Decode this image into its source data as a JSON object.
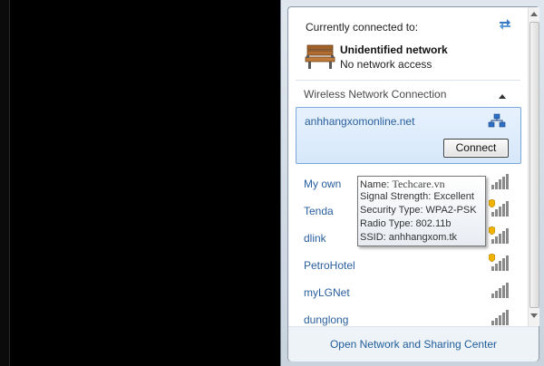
{
  "header": {
    "connected_label": "Currently connected to:",
    "network_name": "Unidentified network",
    "network_status": "No network access",
    "network_icon": "park-bench-icon",
    "refresh_icon": "refresh-arrows-icon"
  },
  "section": {
    "title": "Wireless Network Connection",
    "toggle_icon": "chevron-up-icon"
  },
  "selected_network": {
    "name": "anhhangxomonline.net",
    "connect_label": "Connect",
    "icon": "wired-network-icon"
  },
  "networks": [
    {
      "name": "My own",
      "secured": false,
      "signal_bars": 4
    },
    {
      "name": "Tenda",
      "secured": true,
      "signal_bars": 4
    },
    {
      "name": "dlink",
      "secured": true,
      "signal_bars": 4
    },
    {
      "name": "PetroHotel",
      "secured": true,
      "signal_bars": 4
    },
    {
      "name": "myLGNet",
      "secured": false,
      "signal_bars": 4
    },
    {
      "name": "dunglong",
      "secured": false,
      "signal_bars": 4
    }
  ],
  "tooltip": {
    "name_label": "Name:",
    "name_value": "Techcare.vn",
    "signal": "Signal Strength: Excellent",
    "security": "Security Type: WPA2-PSK",
    "radio": "Radio Type: 802.11b",
    "ssid": "SSID: anhhangxom.tk"
  },
  "footer": {
    "link": "Open Network and Sharing Center"
  },
  "colors": {
    "link": "#2a5f9d",
    "selected_bg": "#d6e8fb",
    "signal_bar": "#8a8a8a",
    "shield": "#f0b400"
  }
}
